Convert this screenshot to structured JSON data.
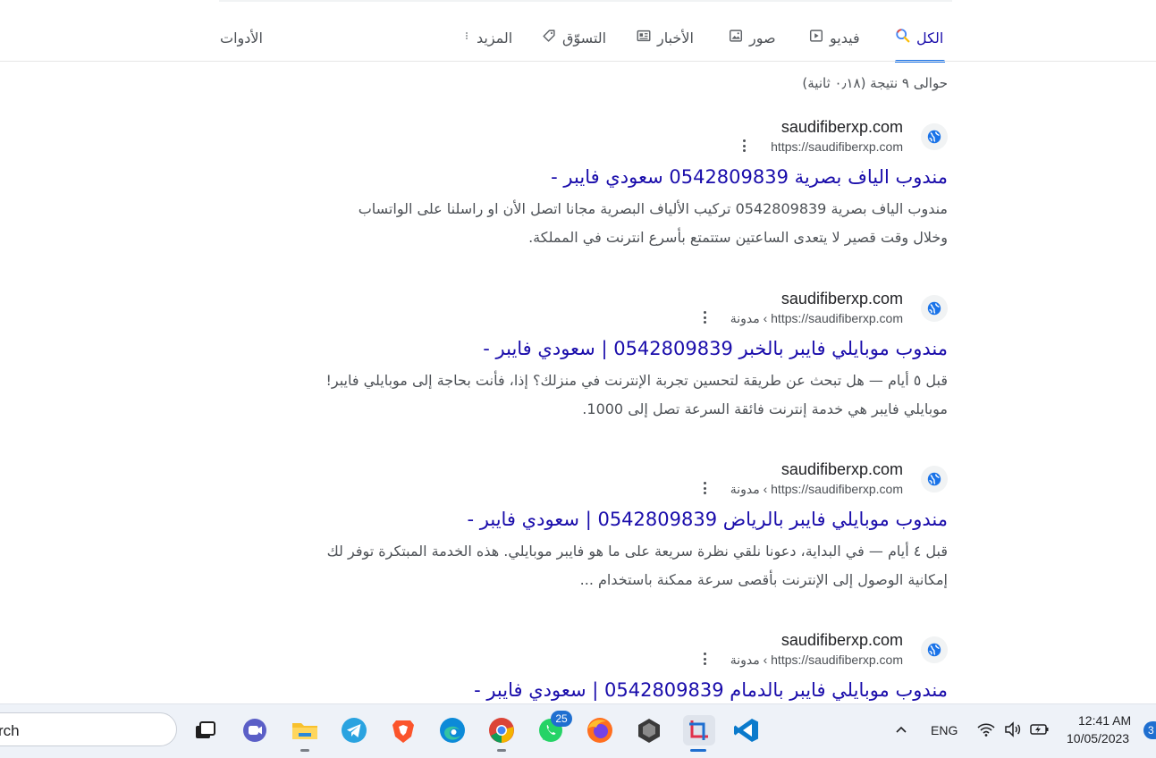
{
  "nav": {
    "tabs": [
      {
        "label": "الكل",
        "icon": "search-icon",
        "active": true
      },
      {
        "label": "فيديو",
        "icon": "video-icon"
      },
      {
        "label": "صور",
        "icon": "image-icon"
      },
      {
        "label": "الأخبار",
        "icon": "news-icon"
      },
      {
        "label": "التسوّق",
        "icon": "tag-icon"
      },
      {
        "label": "المزيد",
        "icon": "more-vert-icon"
      }
    ],
    "tools_label": "الأدوات"
  },
  "result_stats": "حوالى ٩ نتيجة (٠٫١٨ ثانية)",
  "results": [
    {
      "site_name": "saudifiberxp.com",
      "url": "https://saudifiberxp.com",
      "title": "مندوب الياف بصرية 0542809839 سعودي فايبر -",
      "snippet_line1": "مندوب الياف بصرية 0542809839 تركيب الألياف البصرية مجانا اتصل الأن او راسلنا على الواتساب",
      "snippet_line2": "وخلال وقت قصير لا يتعدى الساعتين ستتمتع بأسرع انترنت في المملكة."
    },
    {
      "site_name": "saudifiberxp.com",
      "url": "https://saudifiberxp.com › مدونة",
      "title": "مندوب موبايلي فايبر بالخبر 0542809839 | سعودي فايبر -",
      "snippet_line1": "قبل ٥ أيام — هل تبحث عن طريقة لتحسين تجربة الإنترنت في منزلك؟ إذا، فأنت بحاجة إلى موبايلي فايبر!",
      "snippet_line2": "موبايلي فايبر هي خدمة إنترنت فائقة السرعة تصل إلى 1000."
    },
    {
      "site_name": "saudifiberxp.com",
      "url": "https://saudifiberxp.com › مدونة",
      "title": "مندوب موبايلي فايبر بالرياض 0542809839 | سعودي فايبر -",
      "snippet_line1": "قبل ٤ أيام — في البداية، دعونا نلقي نظرة سريعة على ما هو فايبر موبايلي. هذه الخدمة المبتكرة توفر لك",
      "snippet_line2": "إمكانية الوصول إلى الإنترنت بأقصى سرعة ممكنة باستخدام ..."
    },
    {
      "site_name": "saudifiberxp.com",
      "url": "https://saudifiberxp.com › مدونة",
      "title": "مندوب موبايلي فايبر بالدمام 0542809839 | سعودي فايبر -"
    }
  ],
  "taskbar": {
    "search_text": "rch",
    "whatsapp_badge": "25",
    "language": "ENG",
    "time": "12:41 AM",
    "date": "10/05/2023",
    "notification_count": "3"
  }
}
